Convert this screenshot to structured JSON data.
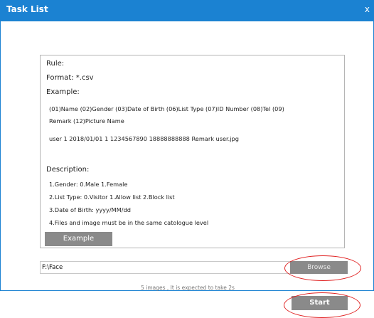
{
  "window": {
    "title": "Task List",
    "close_glyph": "x"
  },
  "rules": {
    "rule_heading": "Rule:",
    "format": "Format: *.csv",
    "example_heading": "Example:",
    "example_fields_line1": "(01)Name  (02)Gender  (03)Date of Birth  (06)List Type  (07)ID Number  (08)Tel  (09)",
    "example_fields_line2": "Remark  (12)Picture Name",
    "example_row": "user  1  2018/01/01  1  1234567890  18888888888  Remark  user.jpg",
    "description_heading": "Description:",
    "descriptions": [
      "1.Gender: 0.Male 1.Female",
      "2.List Type: 0.Visitor 1.Allow list 2.Block list",
      "3.Date of Birth: yyyy/MM/dd",
      "4.Files and image must be in the same catologue level"
    ],
    "example_button": "Example"
  },
  "path": {
    "value": "F:\\Face",
    "browse_label": "Browse"
  },
  "status_text": "5 images , It is expected to take 2s",
  "start_label": "Start",
  "colors": {
    "titlebar": "#1b82d2",
    "button": "#8a8a8a",
    "annotation": "#e02020"
  }
}
